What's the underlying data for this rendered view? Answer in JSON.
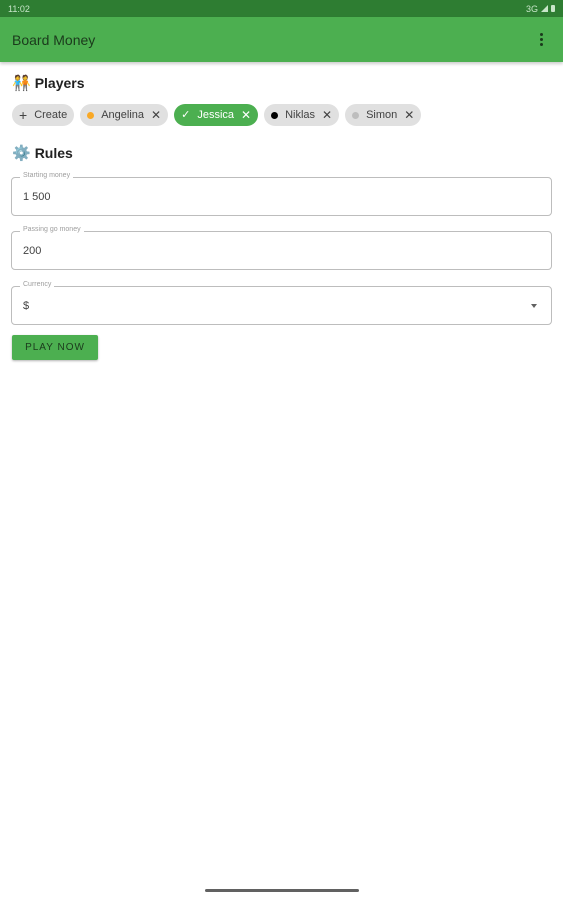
{
  "status_bar": {
    "time": "11:02",
    "network": "3G"
  },
  "app_bar": {
    "title": "Board Money",
    "menu_icon": "more-vert-icon"
  },
  "players_section": {
    "emoji": "🧑‍🤝‍🧑",
    "title": "Players"
  },
  "chips": {
    "create": {
      "label": "Create",
      "icon": "plus-icon"
    },
    "players": [
      {
        "label": "Angelina",
        "color": "#f9a825",
        "selected": false
      },
      {
        "label": "Jessica",
        "color": "#ffffff",
        "selected": true
      },
      {
        "label": "Niklas",
        "color": "#000000",
        "selected": false
      },
      {
        "label": "Simon",
        "color": "#bdbdbd",
        "selected": false
      }
    ]
  },
  "rules_section": {
    "emoji": "⚙️",
    "title": "Rules"
  },
  "fields": {
    "starting_money": {
      "label": "Starting money",
      "value": "1 500"
    },
    "passing_go_money": {
      "label": "Passing go money",
      "value": "200"
    },
    "currency": {
      "label": "Currency",
      "value": "$"
    }
  },
  "play_button": {
    "label": "PLAY NOW"
  },
  "colors": {
    "primary": "#4caf50",
    "primary_dark": "#2e7d32"
  }
}
